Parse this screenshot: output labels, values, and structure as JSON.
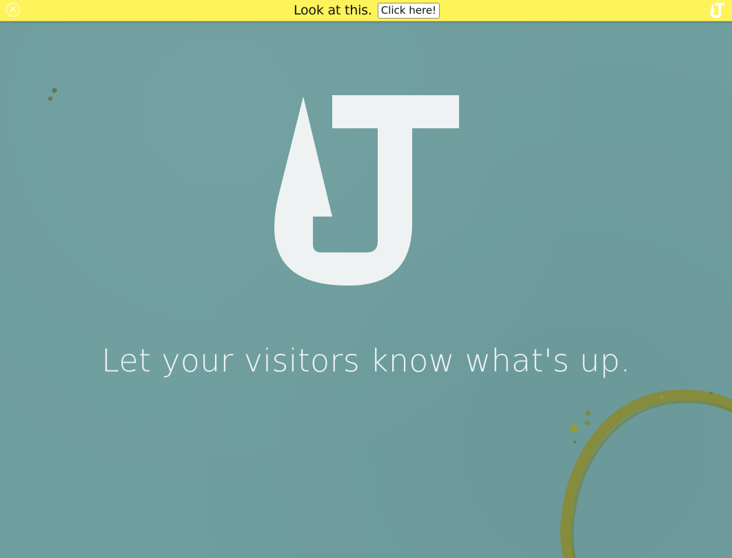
{
  "notification_bar": {
    "message": "Look at this.",
    "button_label": "Click here!",
    "background_color": "#fef35b",
    "close_icon": "close-circle-icon",
    "brand_icon": "hook-j-logo-icon"
  },
  "hero": {
    "logo_icon": "hook-j-logo-icon",
    "tagline": "Let your visitors know what's up.",
    "background_color": "#6f9e9f",
    "text_color": "#f5f7f7"
  },
  "decor": {
    "stain_icon": "coffee-ring-stain",
    "stain_color": "#8a8a2e"
  }
}
